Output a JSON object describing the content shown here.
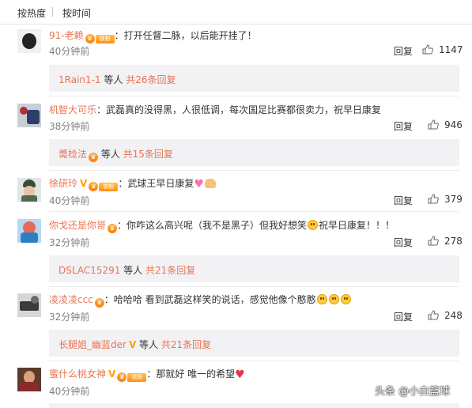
{
  "sort": {
    "hot": "按热度",
    "time": "按时间"
  },
  "comments": [
    {
      "user": "91-老赖",
      "text": "：打开任督二脉，以后能开挂了！",
      "time": "40分钟前",
      "reply": "回复",
      "likes": "1147",
      "sub": {
        "name": "1Rain1-1",
        "mid": " 等人 ",
        "count": "共26条回复"
      }
    },
    {
      "user": "机智大可乐",
      "text": "：武磊真的没得黑，人很低调，每次国足比赛都很卖力，祝早日康复",
      "time": "38分钟前",
      "reply": "回复",
      "likes": "946",
      "sub": {
        "name": "薷棯法",
        "mid": " 等人 ",
        "count": "共15条回复"
      }
    },
    {
      "user": "徐研玲",
      "text": "：武球王早日康复",
      "time": "40分钟前",
      "reply": "回复",
      "likes": "379"
    },
    {
      "user": "你戈还是你哥",
      "text": "：你咋这么高兴呢（我不是黑子）但我好想笑",
      "text2": "祝早日康复！！！",
      "time": "32分钟前",
      "reply": "回复",
      "likes": "278",
      "sub": {
        "name": "DSLAC15291",
        "mid": " 等人 ",
        "count": "共21条回复"
      }
    },
    {
      "user": "凌凌凌ccc",
      "text": "：哈哈哈  看到武磊这样笑的说话，感觉他像个憨憨",
      "time": "32分钟前",
      "reply": "回复",
      "likes": "248",
      "sub": {
        "name": "长腿姐_幽蓝der",
        "mid": " 等人 ",
        "count": "共21条回复"
      }
    },
    {
      "user": "蜜什么桃女神",
      "text": "：那就好 唯一的希望",
      "time": "40分钟前"
    }
  ],
  "badges": {
    "tiefen": "铁粉",
    "vip": "V",
    "verified": "V"
  },
  "watermark": "头条 @小白篮球",
  "colors": {
    "username": "#eb7350",
    "time": "#808080",
    "subbox_bg": "#f2f2f5",
    "text": "#333333"
  },
  "icons": {
    "like": "thumbs-up-icon",
    "heart": "heart-icon",
    "laugh": "laugh-emoji-icon"
  }
}
